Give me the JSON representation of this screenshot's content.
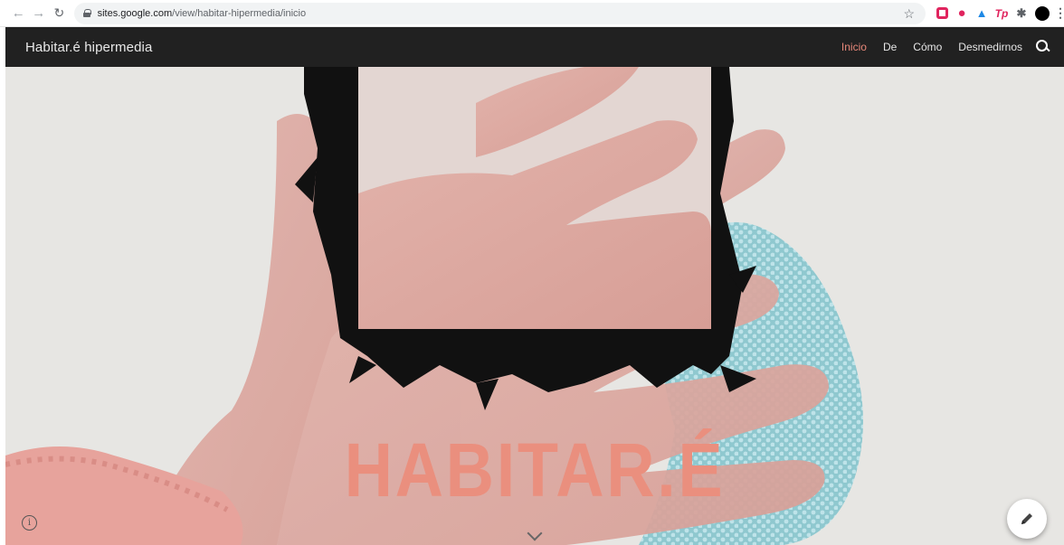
{
  "browser": {
    "url_host": "sites.google.com",
    "url_path": "/view/habitar-hipermedia/inicio",
    "icons": {
      "back": "arrow-left-icon",
      "forward": "arrow-right-icon",
      "reload": "reload-icon",
      "lock": "lock-icon",
      "bookmark": "star-icon",
      "profile": "profile-avatar",
      "menu": "kebab-menu-icon"
    },
    "extensions": [
      "ublock-icon",
      "opera-icon",
      "drop-icon",
      "tp-icon",
      "puzzle-icon"
    ]
  },
  "header": {
    "site_title": "Habitar.é hipermedia",
    "nav": [
      {
        "label": "Inicio",
        "active": true
      },
      {
        "label": "De",
        "active": false
      },
      {
        "label": "Cómo",
        "active": false
      },
      {
        "label": "Desmedirnos",
        "active": false
      }
    ],
    "search_icon": "search-icon",
    "active_color": "#e8887a",
    "bg_color": "#212121"
  },
  "hero": {
    "title": "HABITAR.É",
    "title_color": "#ea8f7e",
    "scroll_icon": "chevron-down-icon",
    "info_icon": "info-icon",
    "info_glyph": "i",
    "edit_icon": "pencil-icon"
  }
}
